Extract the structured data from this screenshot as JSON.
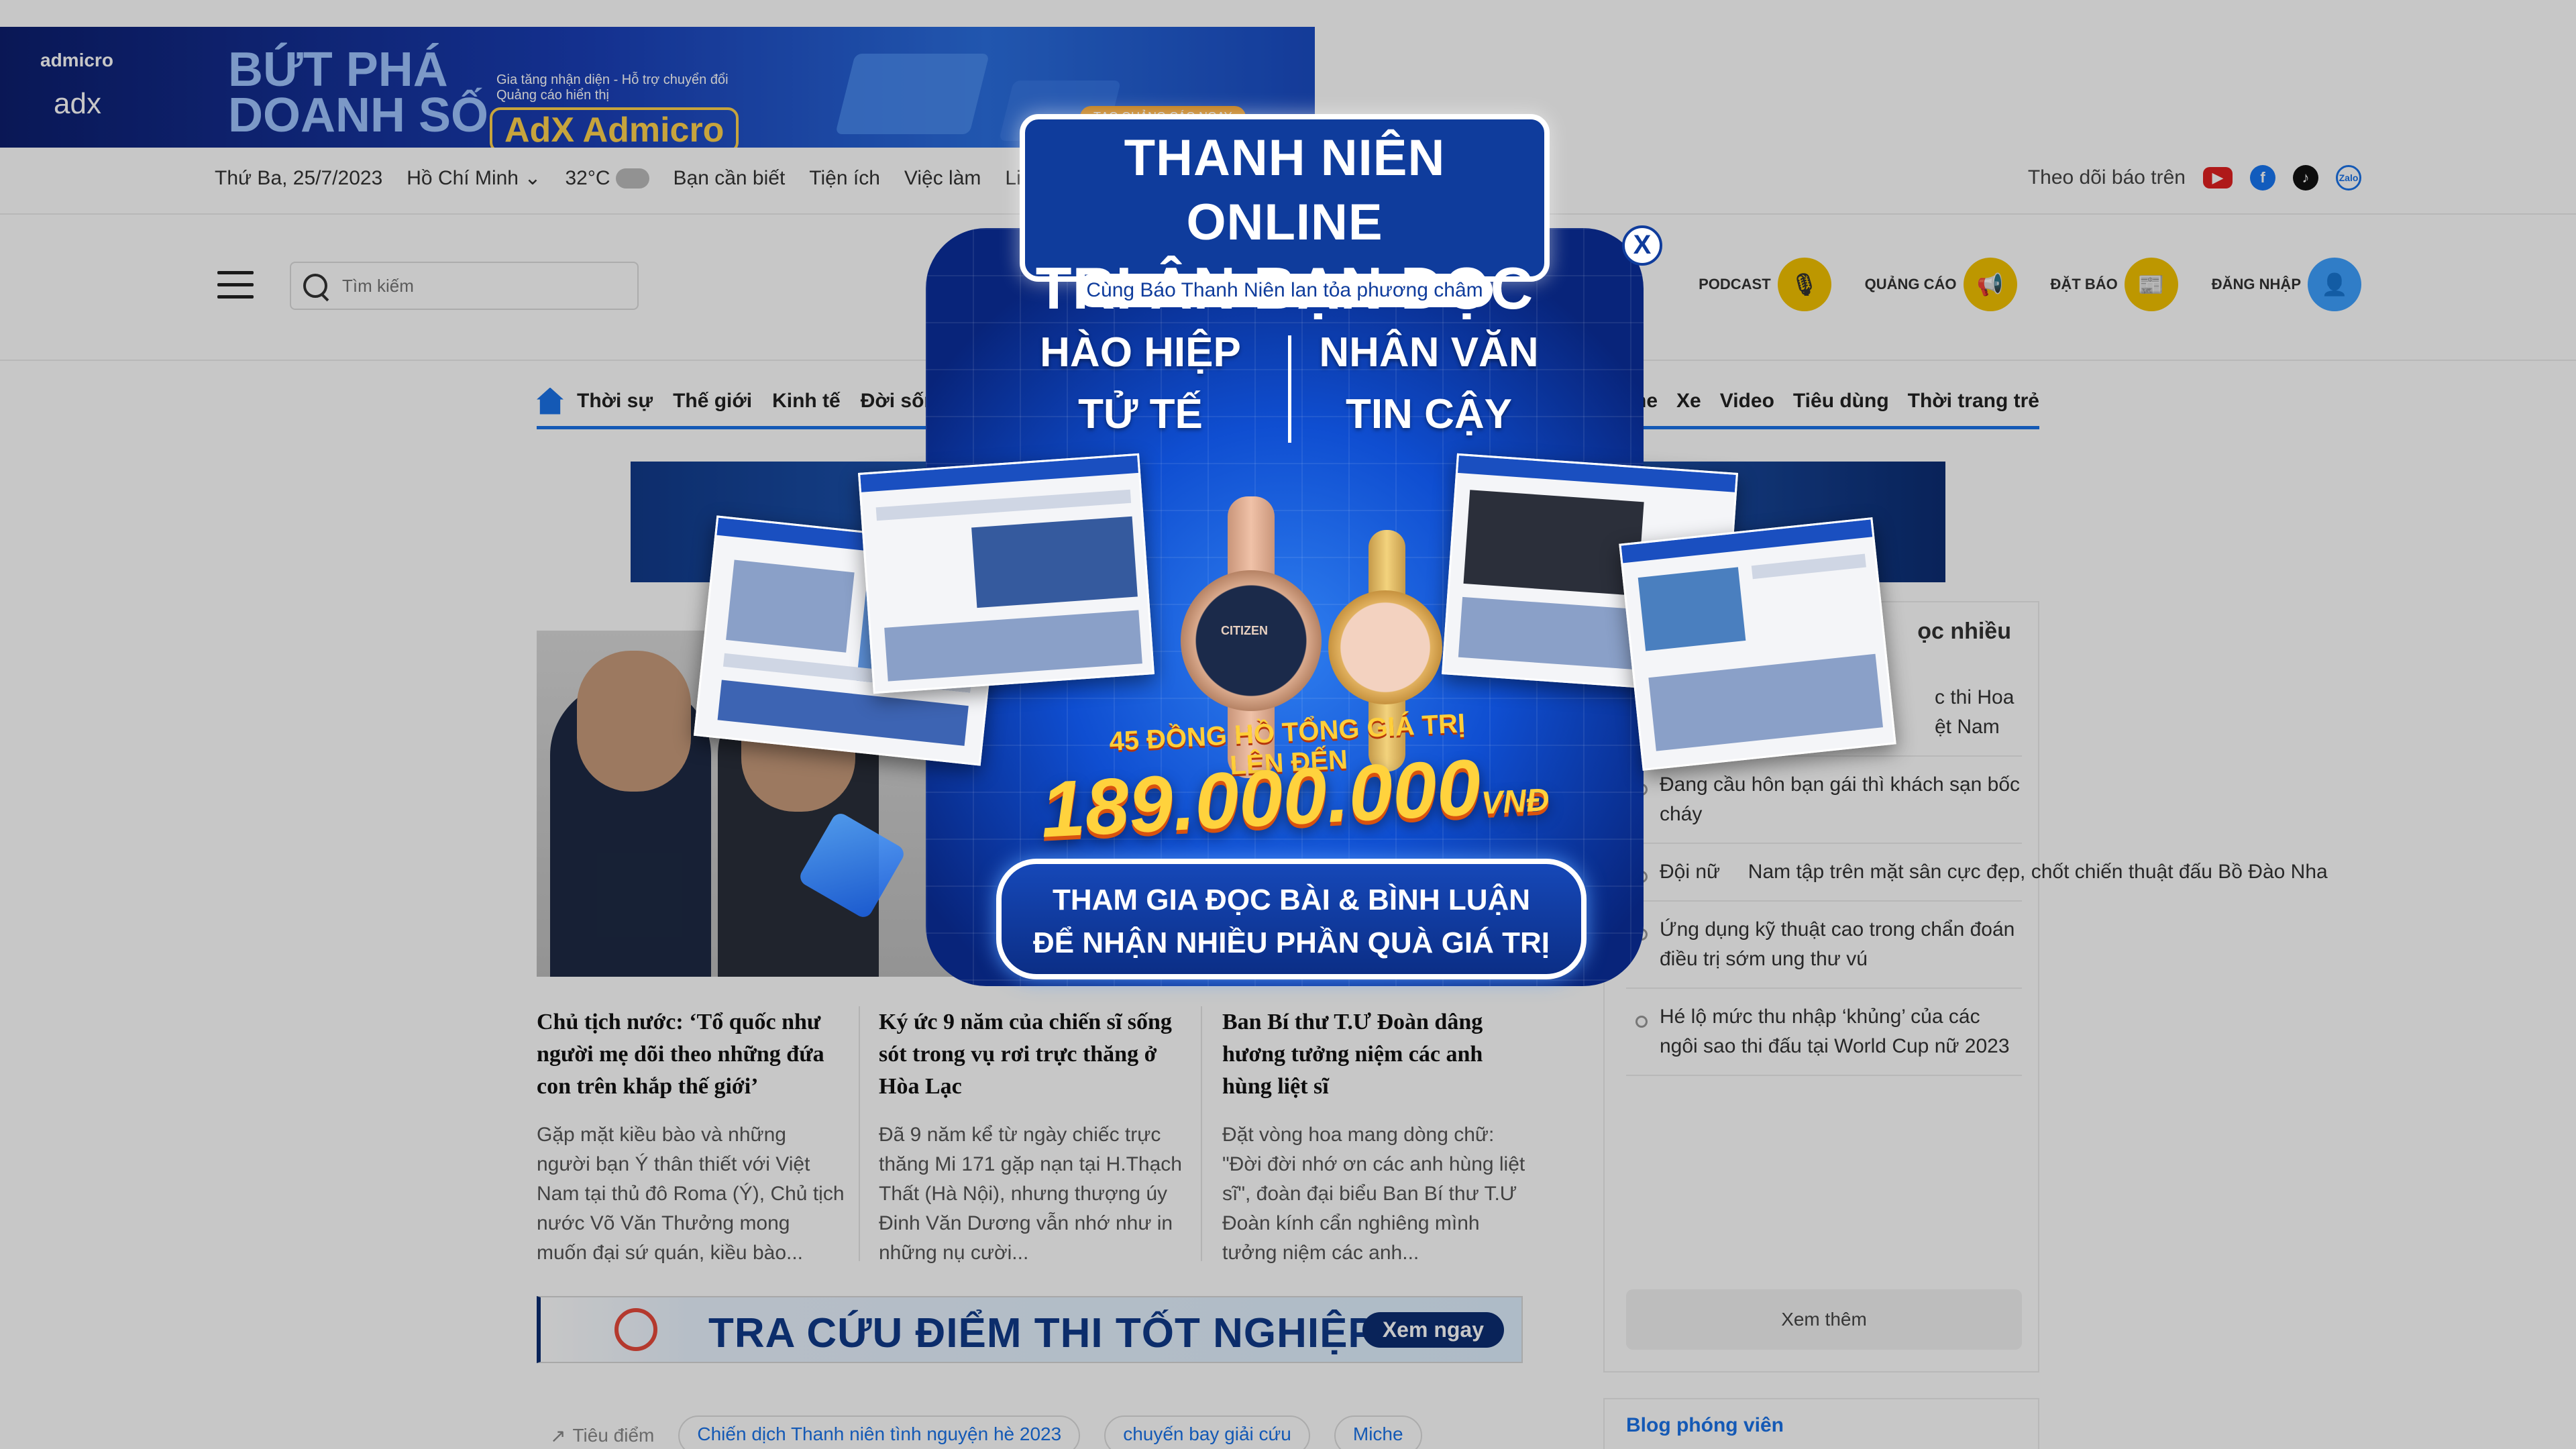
{
  "top_ad": {
    "brand": "admicro",
    "brand2": "adx",
    "headline_1": "BỨT PHÁ",
    "headline_2": "DOANH SỐ",
    "small_1": "Gia tăng nhận diện - Hỗ trợ chuyển đổi",
    "small_2": "Quảng cáo hiển thị",
    "product": "AdX Admicro",
    "cta": "TẠO QUẢNG CÁO NGAY"
  },
  "utility": {
    "date": "Thứ Ba, 25/7/2023",
    "city": "Hồ Chí Minh ⌄",
    "temp": "32°C",
    "links": [
      "Bạn cần biết",
      "Tiện ích",
      "Việc làm",
      "Liên hệ"
    ],
    "follow": "Theo dõi báo trên",
    "zalo": "Zalo"
  },
  "header": {
    "search_placeholder": "Tìm kiếm",
    "buttons": [
      {
        "label": "PODCAST",
        "icon": "mic-icon"
      },
      {
        "label": "QUẢNG CÁO",
        "icon": "megaphone-icon"
      },
      {
        "label": "ĐẶT BÁO",
        "icon": "newspaper-icon"
      },
      {
        "label": "ĐĂNG NHẬP",
        "icon": "user-icon"
      }
    ]
  },
  "nav": {
    "left": [
      "Thời sự",
      "Thế giới",
      "Kinh tế",
      "Đời sống",
      "S"
    ],
    "right": [
      "ame",
      "Xe",
      "Video",
      "Tiêu dùng",
      "Thời trang trẻ"
    ]
  },
  "articles": [
    {
      "title": "Chủ tịch nước: ‘Tổ quốc như người mẹ dõi theo những đứa con trên khắp thế giới’",
      "summary": "Gặp mặt kiều bào và những người bạn Ý thân thiết với Việt Nam tại thủ đô Roma (Ý), Chủ tịch nước Võ Văn Thưởng mong muốn đại sứ quán, kiều bào..."
    },
    {
      "title": "Ký ức 9 năm của chiến sĩ sống sót trong vụ rơi trực thăng ở Hòa Lạc",
      "summary": "Đã 9 năm kể từ ngày chiếc trực thăng Mi 171 gặp nạn tại H.Thạch Thất (Hà Nội), nhưng thượng úy Đinh Văn Dương vẫn nhớ như in những nụ cười..."
    },
    {
      "title": "Ban Bí thư T.Ư Đoàn dâng hương tưởng niệm các anh hùng liệt sĩ",
      "summary": "Đặt vòng hoa mang dòng chữ: \"Đời đời nhớ ơn các anh hùng liệt sĩ\", đoàn đại biểu Ban Bí thư T.Ư Đoàn kính cẩn nghiêng mình tưởng niệm các anh..."
    }
  ],
  "thpt_banner": {
    "text": "TRA CỨU ĐIỂM THI TỐT NGHIỆP THPT",
    "button": "Xem ngay"
  },
  "tags": {
    "label": "Tiêu điểm",
    "items": [
      "Chiến dịch Thanh niên tình nguyện hè 2023",
      "chuyến bay giải cứu",
      "Miche"
    ]
  },
  "sidebar": {
    "heading": "ọc nhiều",
    "items": [
      "c thi Hoa\nệt Nam",
      "Đang cầu hôn bạn gái thì khách sạn bốc cháy",
      "Đội nữ     Nam tập trên mặt sân cực đẹp, chốt chiến thuật đấu Bồ Đào Nha",
      "Ứng dụng kỹ thuật cao trong chẩn đoán điều trị sớm ung thư vú",
      "Hé lộ mức thu nhập ‘khủng’ của các ngôi sao thi đấu tại World Cup nữ 2023"
    ],
    "more": "Xem thêm",
    "blog": "Blog phóng viên"
  },
  "popup": {
    "title_1": "THANH NIÊN ONLINE",
    "title_2": "TRI ÂN BẠN ĐỌC",
    "subtitle": "Cùng Báo Thanh Niên lan tỏa phương châm",
    "value_left": "HÀO HIỆP\nTỬ TẾ",
    "value_right": "NHÂN VĂN\nTIN CẬY",
    "count_text": "45 ĐỒNG HỒ TỔNG GIÁ TRỊ LÊN ĐẾN",
    "prize": "189.000.000",
    "prize_unit": "VNĐ",
    "cta_1": "THAM GIA ĐỌC BÀI & BÌNH LUẬN",
    "cta_2": "ĐỂ NHẬN NHIỀU PHẦN QUÀ GIÁ TRỊ",
    "close": "X",
    "watch_brand": "CITIZEN"
  }
}
